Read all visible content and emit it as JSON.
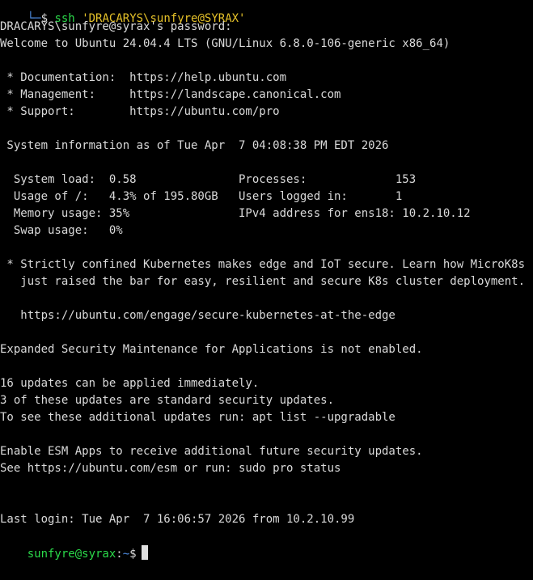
{
  "colors": {
    "background": "#000000",
    "text": "#d9d9d9",
    "prompt_user": "#2bd94a",
    "prompt_path": "#4f8fe6",
    "command_arg": "#e6c229"
  },
  "prev_prompt": {
    "corner": "└─",
    "dollar": "$",
    "command": "ssh",
    "argument": "'DRACARYS\\sunfyre@SYRAX'"
  },
  "lines": [
    "DRACARYS\\sunfyre@syrax's password:",
    "Welcome to Ubuntu 24.04.4 LTS (GNU/Linux 6.8.0-106-generic x86_64)",
    "",
    " * Documentation:  https://help.ubuntu.com",
    " * Management:     https://landscape.canonical.com",
    " * Support:        https://ubuntu.com/pro",
    "",
    " System information as of Tue Apr  7 04:08:38 PM EDT 2026",
    "",
    "  System load:  0.58               Processes:             153",
    "  Usage of /:   4.3% of 195.80GB   Users logged in:       1",
    "  Memory usage: 35%                IPv4 address for ens18: 10.2.10.12",
    "  Swap usage:   0%",
    "",
    " * Strictly confined Kubernetes makes edge and IoT secure. Learn how MicroK8s",
    "   just raised the bar for easy, resilient and secure K8s cluster deployment.",
    "",
    "   https://ubuntu.com/engage/secure-kubernetes-at-the-edge",
    "",
    "Expanded Security Maintenance for Applications is not enabled.",
    "",
    "16 updates can be applied immediately.",
    "3 of these updates are standard security updates.",
    "To see these additional updates run: apt list --upgradable",
    "",
    "Enable ESM Apps to receive additional future security updates.",
    "See https://ubuntu.com/esm or run: sudo pro status",
    "",
    "",
    "Last login: Tue Apr  7 16:06:57 2026 from 10.2.10.99"
  ],
  "prompt": {
    "user_host": "sunfyre@syrax",
    "separator": ":",
    "path": "~",
    "dollar": "$"
  }
}
